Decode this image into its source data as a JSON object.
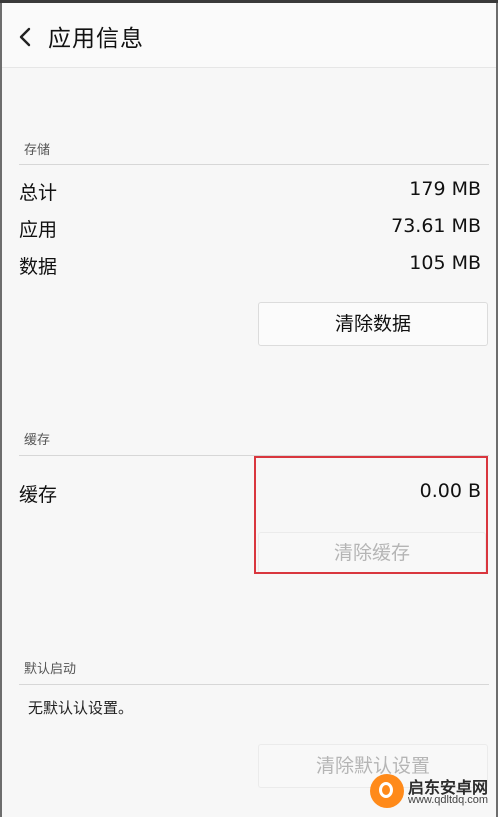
{
  "header": {
    "title": "应用信息"
  },
  "storage": {
    "section_label": "存储",
    "rows": [
      {
        "label": "总计",
        "value": "179 MB"
      },
      {
        "label": "应用",
        "value": "73.61 MB"
      },
      {
        "label": "数据",
        "value": "105 MB"
      }
    ],
    "clear_data_label": "清除数据"
  },
  "cache": {
    "section_label": "缓存",
    "row": {
      "label": "缓存",
      "value": "0.00 B"
    },
    "clear_cache_label": "清除缓存",
    "clear_cache_enabled": false
  },
  "default_launch": {
    "section_label": "默认启动",
    "status_text": "无默认认设置。",
    "clear_defaults_label": "清除默认设置",
    "clear_defaults_enabled": false
  },
  "watermark": {
    "text": "启东安卓网",
    "url": "www.qdltdq.com"
  },
  "colors": {
    "highlight": "#d9363e",
    "watermark_logo": "#ff8a1a"
  },
  "icons": {
    "back": "chevron-left-icon"
  }
}
